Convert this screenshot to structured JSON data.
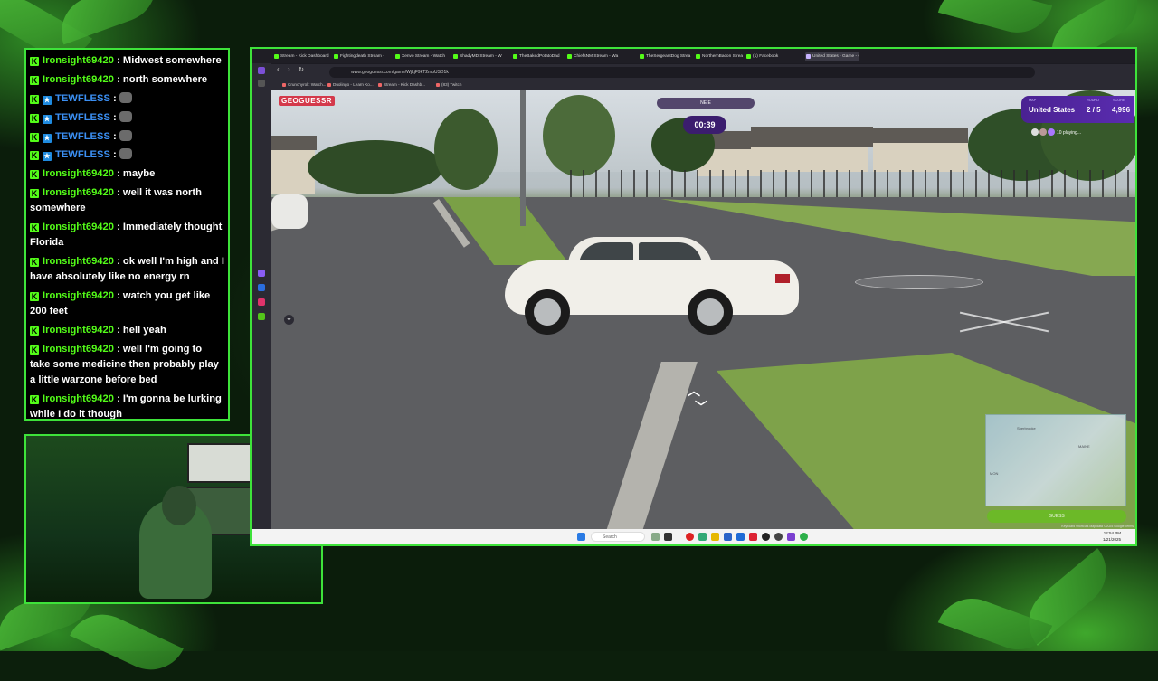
{
  "chat": {
    "messages": [
      {
        "user": "Ironsight69420",
        "text": " : Midwest somewhere",
        "badge": "k",
        "color": "green"
      },
      {
        "user": "Ironsight69420",
        "text": " : north somewhere",
        "badge": "k",
        "color": "green"
      },
      {
        "user": "TEWFLESS",
        "text": " : ",
        "badge": "k",
        "badge2": "sub",
        "color": "blue",
        "emote": true
      },
      {
        "user": "TEWFLESS",
        "text": " : ",
        "badge": "k",
        "badge2": "sub",
        "color": "blue",
        "emote": true
      },
      {
        "user": "TEWFLESS",
        "text": " : ",
        "badge": "k",
        "badge2": "sub",
        "color": "blue",
        "emote": true
      },
      {
        "user": "TEWFLESS",
        "text": " : ",
        "badge": "k",
        "badge2": "sub",
        "color": "blue",
        "emote": true
      },
      {
        "user": "Ironsight69420",
        "text": " : maybe",
        "badge": "k",
        "color": "green"
      },
      {
        "user": "Ironsight69420",
        "text": " : well it was north somewhere",
        "badge": "k",
        "color": "green"
      },
      {
        "user": "Ironsight69420",
        "text": " : Immediately thought Florida",
        "badge": "k",
        "color": "green"
      },
      {
        "user": "Ironsight69420",
        "text": " : ok well I'm high and I have absolutely like no energy rn",
        "badge": "k",
        "color": "green"
      },
      {
        "user": "Ironsight69420",
        "text": " : watch you get like 200 feet",
        "badge": "k",
        "color": "green"
      },
      {
        "user": "Ironsight69420",
        "text": " : hell yeah",
        "badge": "k",
        "color": "green"
      },
      {
        "user": "Ironsight69420",
        "text": " : well I'm going to take some medicine then probably play a little warzone before bed",
        "badge": "k",
        "color": "green"
      },
      {
        "user": "Ironsight69420",
        "text": " : I'm gonna be lurking while I do it though",
        "badge": "k",
        "color": "green"
      }
    ]
  },
  "browser": {
    "tabs": [
      "Stream - Kick Dashboard",
      "Fightingdeath Stream -",
      "Xenvo Stream - Watch",
      "ShadyMD Stream - W",
      "TheBakedPotatoDad",
      "ChiefsNM Stream - Wa",
      "TheSergeantDog Strea",
      "NorthernBacon Strea",
      "(1) Facebook",
      "United States - Game - G"
    ],
    "active_tab": 9,
    "url": "www.geoguessr.com/game/WjLjF9kT2mpUSD1k",
    "bookmarks": [
      "Crunchyroll: Watch...",
      "Duolingo - Learn Ko...",
      "Stream - Kick Dashb...",
      "(83) Twitch"
    ]
  },
  "game": {
    "logo": "GEOGUESSR",
    "compass": "NE    E",
    "timer": "00:39",
    "map_label": "MAP",
    "map_value": "United States",
    "round_label": "ROUND",
    "round_value": "2 / 5",
    "score_label": "SCORE",
    "score_value": "4,996",
    "players_text": "10 playing...",
    "guess_label": "GUESS",
    "minimap_labels": [
      "MAINE",
      "MON",
      "Sherbrooke"
    ],
    "attribution": "Keyboard shortcuts  Map data ©2025 Google  Terms"
  },
  "taskbar": {
    "search_placeholder": "Search",
    "time": "12:54 PM",
    "date": "1/21/2025"
  }
}
